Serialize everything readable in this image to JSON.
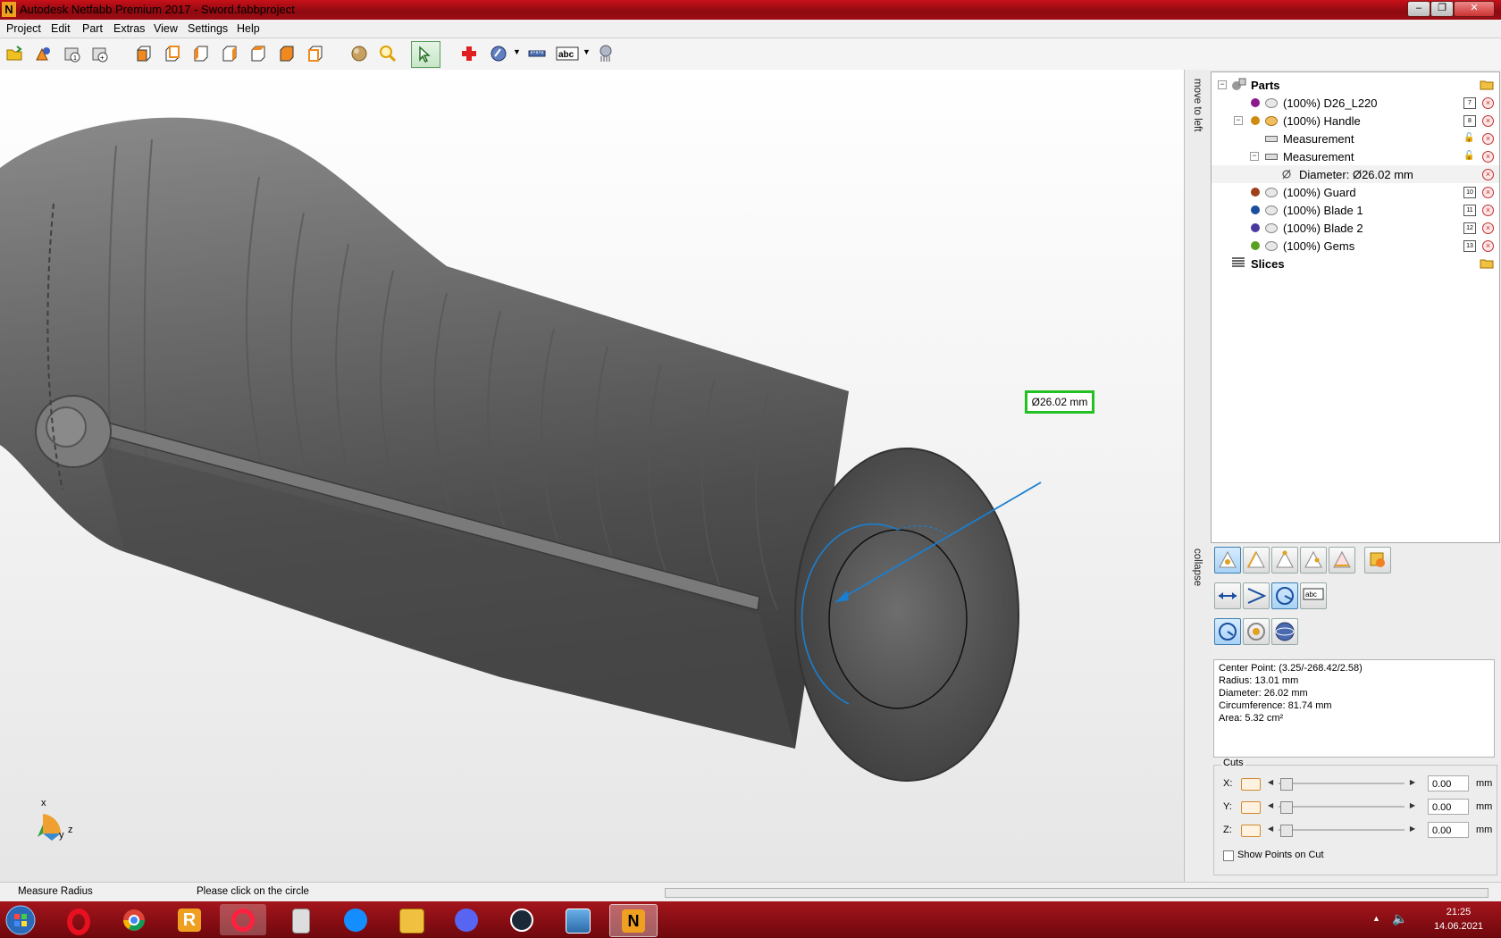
{
  "window": {
    "title": "Autodesk Netfabb Premium 2017 - Sword.fabbproject",
    "app_icon_letter": "N"
  },
  "menu": [
    "Project",
    "Edit",
    "Part",
    "Extras",
    "View",
    "Settings",
    "Help"
  ],
  "viewport": {
    "measurement_label": "Ø26.02 mm",
    "axis": {
      "x": "x",
      "y": "y",
      "z": "z"
    }
  },
  "side_strip": {
    "top_label": "move to left",
    "bottom_label": "collapse"
  },
  "tree": {
    "parts_label": "Parts",
    "items": [
      {
        "label": "(100%) D26_L220",
        "color": "#8b1a8b",
        "badge": "7"
      },
      {
        "label": "(100%) Handle",
        "color": "#d08a10",
        "badge": "8"
      },
      {
        "label": "Measurement"
      },
      {
        "label": "Measurement"
      },
      {
        "label": "Diameter: Ø26.02 mm"
      },
      {
        "label": "(100%) Guard",
        "color": "#a0401a",
        "badge": "10"
      },
      {
        "label": "(100%) Blade 1",
        "color": "#1a4fa0",
        "badge": "11"
      },
      {
        "label": "(100%) Blade 2",
        "color": "#4a3aa0",
        "badge": "12"
      },
      {
        "label": "(100%) Gems",
        "color": "#5aa020",
        "badge": "13"
      }
    ],
    "slices_label": "Slices"
  },
  "info": {
    "center_point": "Center Point: (3.25/-268.42/2.58)",
    "radius": "Radius: 13.01 mm",
    "diameter": "Diameter: 26.02 mm",
    "circumference": "Circumference: 81.74 mm",
    "area": "Area: 5.32 cm²"
  },
  "cuts": {
    "title": "Cuts",
    "x_label": "X:",
    "y_label": "Y:",
    "z_label": "Z:",
    "x_value": "0.00",
    "y_value": "0.00",
    "z_value": "0.00",
    "unit": "mm",
    "show_points_label": "Show Points on Cut"
  },
  "status": {
    "mode": "Measure Radius",
    "hint": "Please click on the circle"
  },
  "taskbar": {
    "time": "21:25",
    "date": "14.06.2021"
  },
  "colors": {
    "title_red": "#b0101a",
    "accent_blue": "#1a7fd0",
    "label_green": "#22c022"
  }
}
